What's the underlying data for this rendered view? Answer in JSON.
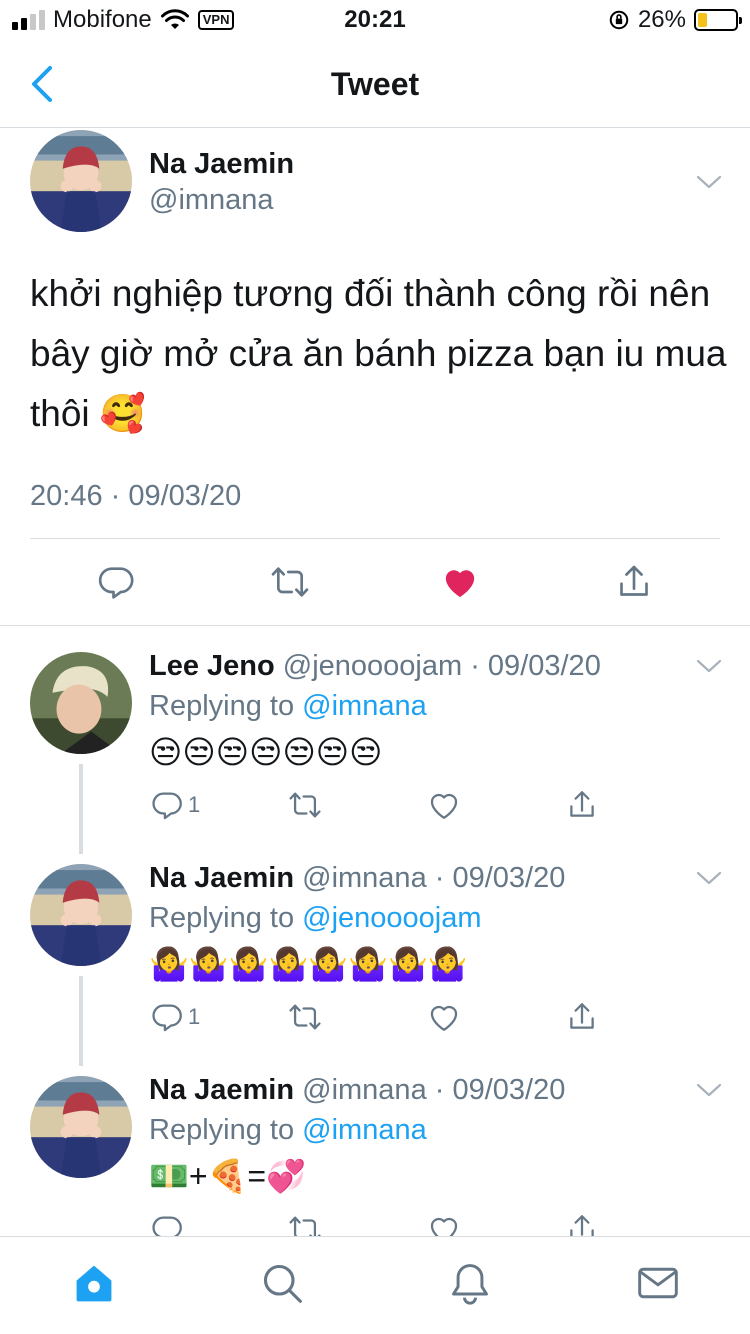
{
  "status_bar": {
    "carrier": "Mobifone",
    "vpn": "VPN",
    "time": "20:21",
    "battery": "26%",
    "battery_level": 0.26
  },
  "nav": {
    "title": "Tweet"
  },
  "main_tweet": {
    "name": "Na Jaemin",
    "handle": "@imnana",
    "text": "khởi nghiệp tương đối thành công rồi nên bây giờ mở cửa ăn bánh pizza bạn iu mua thôi 🥰",
    "timestamp": "20:46 · 09/03/20",
    "liked": true
  },
  "replies": [
    {
      "name": "Lee Jeno",
      "handle": "@jenoooojam · 09/03/20",
      "replying_prefix": "Replying to ",
      "replying_to": "@imnana",
      "content": "😒😒😒😒😒😒😒",
      "reply_count": "1"
    },
    {
      "name": "Na Jaemin",
      "handle": "@imnana · 09/03/20",
      "replying_prefix": "Replying to ",
      "replying_to": "@jenoooojam",
      "content": "🤷‍♀️🤷‍♀️🤷‍♀️🤷‍♀️🤷‍♀️🤷‍♀️🤷‍♀️🤷‍♀️",
      "reply_count": "1"
    },
    {
      "name": "Na Jaemin",
      "handle": "@imnana · 09/03/20",
      "replying_prefix": "Replying to ",
      "replying_to": "@imnana",
      "content": "💵+🍕=💞",
      "reply_count": ""
    }
  ],
  "colors": {
    "accent": "#1da1f2",
    "like": "#e0245e",
    "secondary_text": "#657786",
    "divider": "#d8dde1"
  },
  "icons": {
    "back": "chevron-left-icon",
    "reply": "comment-icon",
    "retweet": "retweet-icon",
    "like": "heart-icon",
    "share": "share-icon",
    "home": "home-icon",
    "search": "search-icon",
    "notifications": "bell-icon",
    "messages": "mail-icon"
  }
}
